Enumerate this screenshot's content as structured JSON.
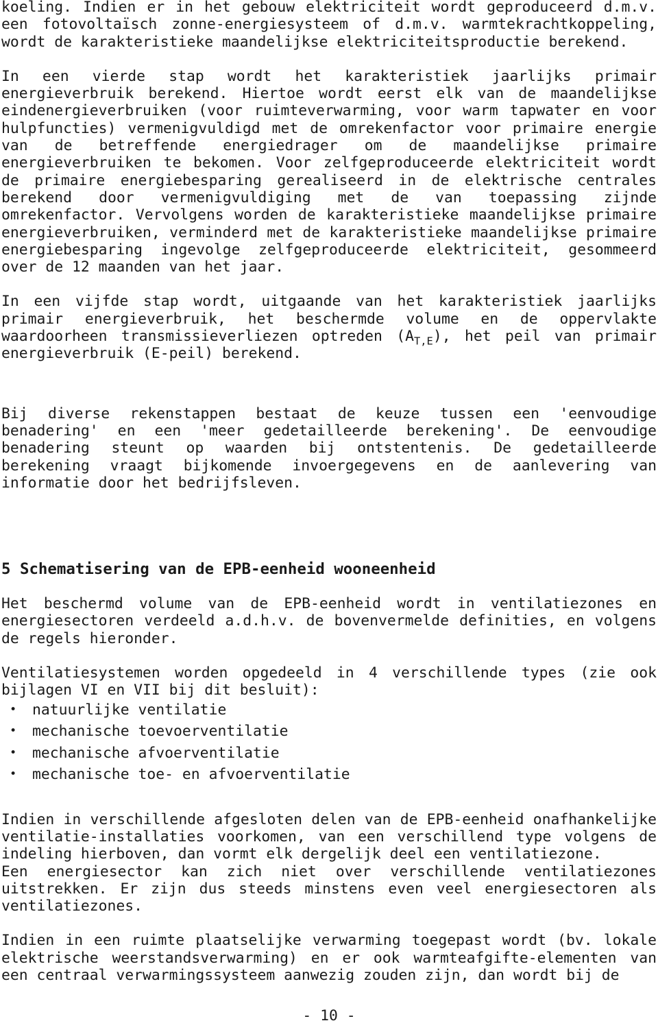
{
  "document": {
    "language": "nl",
    "page_number_label": "- 10 -",
    "text_color": "#1a1a1a",
    "background_color": "#ffffff"
  },
  "paragraphs": {
    "p1_continued": "koeling. Indien er in het gebouw elektriciteit wordt geproduceerd d.m.v. een fotovoltaïsch zonne-energiesysteem of d.m.v. warmtekrachtkoppeling, wordt de karakteristieke maandelijkse elektriciteitsproductie berekend.",
    "p2_vierde_stap": "In een vierde stap wordt het karakteristiek jaarlijks primair energieverbruik berekend. Hiertoe wordt eerst elk van de maandelijkse eindenergieverbruiken (voor ruimteverwarming, voor warm tapwater en voor hulpfuncties)  vermenigvuldigd met de omrekenfactor voor primaire energie van de betreffende energiedrager om de maandelijkse primaire energieverbruiken te bekomen. Voor zelfgeproduceerde elektriciteit wordt de primaire energiebesparing gerealiseerd in de elektrische centrales berekend door vermenigvuldiging met de van toepassing zijnde omrekenfactor. Vervolgens worden de karakteristieke maandelijkse primaire energieverbruiken, verminderd met de karakteristieke maandelijkse primaire energiebesparing ingevolge zelfgeproduceerde elektriciteit, gesommeerd over de 12 maanden van het jaar.",
    "p3_vijfde_stap_part1": "In een vijfde stap wordt, uitgaande van het karakteristiek jaarlijks primair energieverbruik, het beschermde volume en de oppervlakte waardoorheen transmissieverliezen optreden (A",
    "p3_subscript": "T,E",
    "p3_vijfde_stap_part2": "), het peil van primair energieverbruik (E-peil) berekend.",
    "p4_rekenstappen": "Bij diverse rekenstappen bestaat de keuze tussen een 'eenvoudige benadering' en een 'meer gedetailleerde berekening'. De eenvoudige benadering steunt op waarden bij ontstentenis. De gedetailleerde berekening vraagt bijkomende invoergegevens en de aanlevering van informatie door het bedrijfsleven.",
    "p5_beschermd_volume": "Het beschermd volume van de EPB-eenheid wordt in ventilatiezones en energiesectoren verdeeld a.d.h.v. de bovenvermelde definities, en volgens de regels hieronder.",
    "p6_ventilatiesystemen_intro": "Ventilatiesystemen worden opgedeeld in 4 verschillende types (zie ook bijlagen VI en VII bij dit besluit):",
    "p7_afgesloten_delen": "Indien in verschillende afgesloten delen van de EPB-eenheid onafhankelijke ventilatie-installaties voorkomen, van een verschillend type volgens de indeling hierboven, dan vormt elk dergelijk deel een ventilatiezone.",
    "p8_energiesector": "Een energiesector kan zich niet over verschillende ventilatiezones uitstrekken.  Er zijn dus steeds minstens even veel energiesectoren als ventilatiezones.",
    "p9_plaatselijke_verwarming": "Indien in een ruimte plaatselijke verwarming toegepast wordt (bv. lokale elektrische weerstandsverwarming) en er ook warmteafgifte-elementen van een centraal verwarmingssysteem aanwezig zouden zijn, dan wordt bij de"
  },
  "heading": {
    "section_5": "5 Schematisering van de EPB-eenheid wooneenheid"
  },
  "ventilation_types": {
    "bullet_glyph": "•",
    "items": [
      "natuurlijke ventilatie",
      "mechanische toevoerventilatie",
      "mechanische afvoerventilatie",
      "mechanische toe- en afvoerventilatie"
    ]
  }
}
